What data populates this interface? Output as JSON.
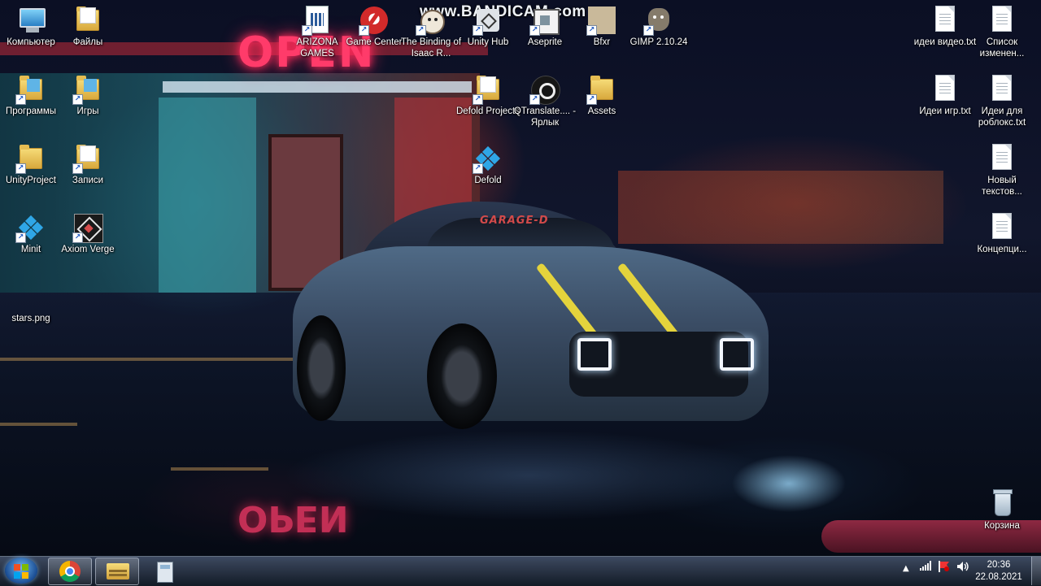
{
  "watermark": "www.BANDICAM.com",
  "wallpaper": {
    "sign_text": "OPEN",
    "sign_reflection": "OPEN",
    "car_windshield_text": "GARAGE-D"
  },
  "desktop_icons": {
    "computer": "Компьютер",
    "files": "Файлы",
    "programs": "Программы",
    "games": "Игры",
    "unity_project": "UnityProject",
    "recordings": "Записи",
    "minit": "Minit",
    "axiom_verge": "Axiom Verge",
    "stars": "stars.png",
    "arizona": "ARIZONA GAMES",
    "game_center": "Game Center",
    "binding": "The Binding of Isaac R...",
    "unity_hub": "Unity Hub",
    "aseprite": "Aseprite",
    "bfxr": "Bfxr",
    "gimp": "GIMP 2.10.24",
    "defold_projects": "Defold Projects",
    "qtranslate": "QTranslate.... - Ярлык",
    "assets": "Assets",
    "defold": "Defold",
    "video_ideas": "идеи видео.txt",
    "change_list": "Список изменен...",
    "game_ideas": "Идеи игр.txt",
    "roblox_ideas": "Идеи для роблокс.txt",
    "new_text": "Новый текстов...",
    "concept": "Концепци...",
    "recycle_bin": "Корзина"
  },
  "taskbar": {
    "time": "20:36",
    "date": "22.08.2021",
    "apps": [
      "chrome-icon",
      "explorer-icon",
      "calculator-icon"
    ],
    "tray_icons": [
      "show-hidden-icon",
      "signal-icon",
      "flag-icon",
      "volume-icon"
    ]
  },
  "colors": {
    "label_text": "#ffffff",
    "taskbar": "#2a3546",
    "neon_sign": "#ff3b6a"
  }
}
